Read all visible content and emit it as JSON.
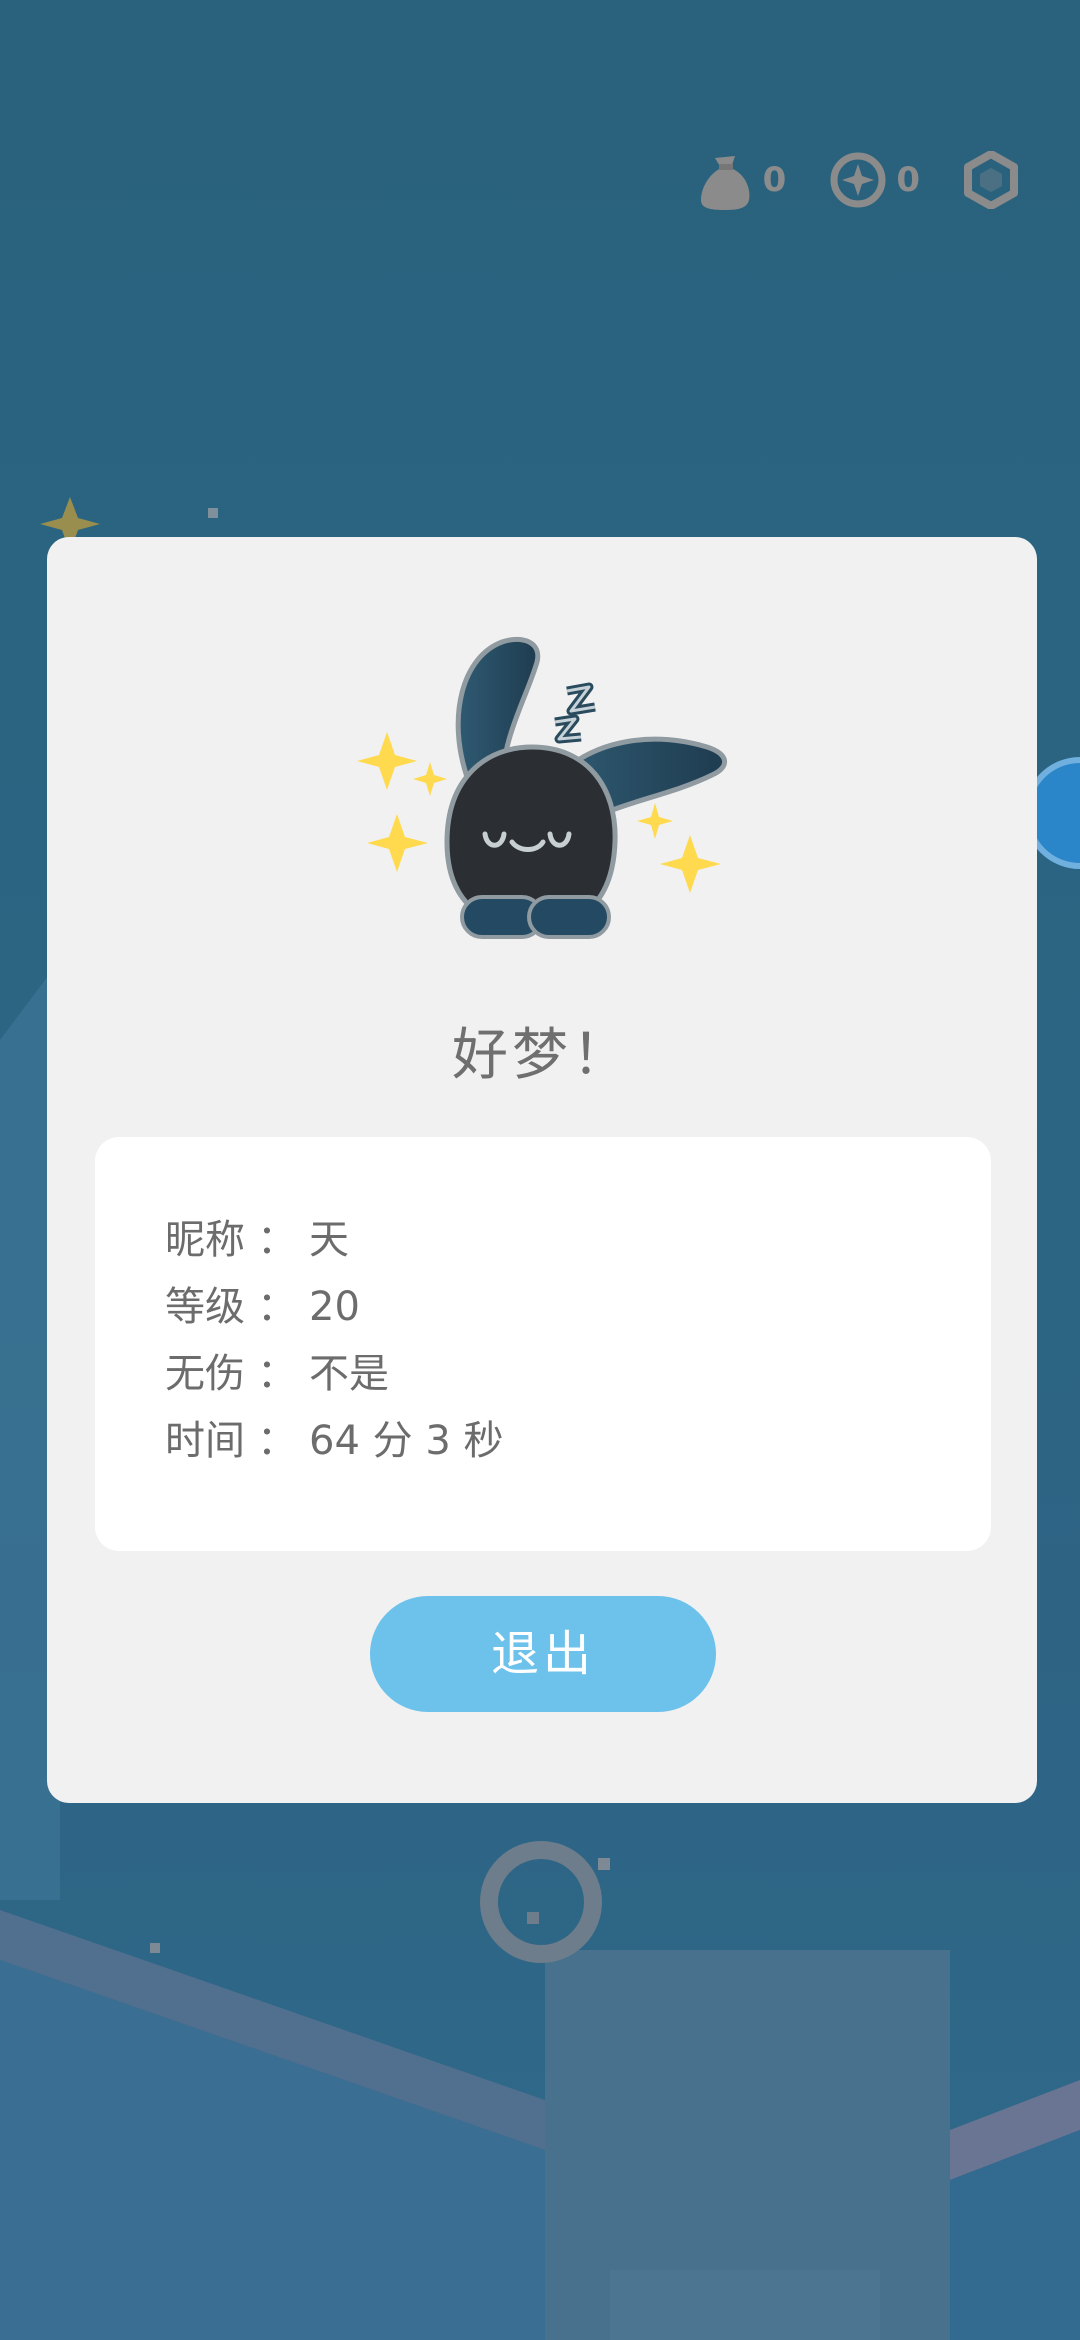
{
  "hud": {
    "bag_icon": "money-bag-icon",
    "bag_count": "0",
    "compass_icon": "compass-coin-icon",
    "compass_count": "0",
    "settings_icon": "hexagon-settings-icon"
  },
  "dialog": {
    "mascot_icon": "sleeping-bunny-icon",
    "title": "好梦！",
    "info": [
      {
        "label": "昵称",
        "sep": "：",
        "value": "天"
      },
      {
        "label": "等级",
        "sep": "：",
        "value": "20"
      },
      {
        "label": "无伤",
        "sep": "：",
        "value": "不是"
      },
      {
        "label": "时间",
        "sep": "：",
        "value": "64 分 3 秒"
      }
    ],
    "exit_label": "退出"
  },
  "colors": {
    "background": "#2b6583",
    "dialog_bg": "#f1f1f1",
    "info_bg": "#ffffff",
    "button_bg": "#6dc2ec",
    "text_gray": "#6c6c6c",
    "hud_gray": "#8c8c8c"
  }
}
